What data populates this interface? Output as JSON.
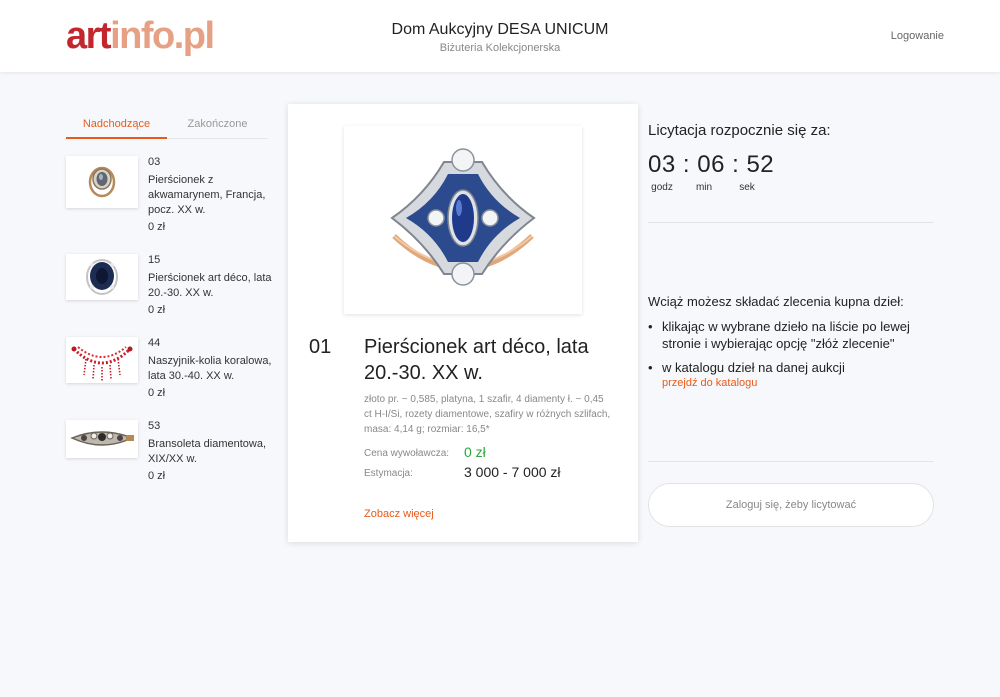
{
  "header": {
    "logo_part1": "art",
    "logo_part2": "info.pl",
    "title": "Dom Aukcyjny DESA UNICUM",
    "subtitle": "Biżuteria Kolekcjonerska",
    "login_label": "Logowanie"
  },
  "tabs": [
    {
      "label": "Nadchodzące",
      "active": true
    },
    {
      "label": "Zakończone",
      "active": false
    }
  ],
  "lots": [
    {
      "number": "03",
      "name": "Pierścionek z akwamarynem, Francja, pocz. XX w.",
      "price": "0 zł"
    },
    {
      "number": "15",
      "name": "Pierścionek art déco, lata 20.-30. XX w.",
      "price": "0 zł"
    },
    {
      "number": "44",
      "name": "Naszyjnik-kolia koralowa, lata 30.-40. XX w.",
      "price": "0 zł"
    },
    {
      "number": "53",
      "name": "Bransoleta diamentowa, XIX/XX w.",
      "price": "0 zł"
    }
  ],
  "selected_lot": {
    "number": "01",
    "title": "Pierścionek art déco, lata 20.-30. XX w.",
    "description": "złoto pr. ~ 0,585, platyna, 1 szafir, 4 diamenty ł. ~ 0,45 ct H-I/Si, rozety diamentowe, szafiry w różnych szlifach, masa: 4,14 g; rozmiar: 16,5*",
    "start_label": "Cena wywoławcza:",
    "start_value": "0 zł",
    "estimate_label": "Estymacja:",
    "estimate_value": "3 000 - 7 000 zł",
    "see_more": "Zobacz więcej"
  },
  "countdown": {
    "title": "Licytacja rozpocznie się za:",
    "hours": "03",
    "minutes": "06",
    "seconds": "52",
    "separator": ":",
    "hours_label": "godz",
    "minutes_label": "min",
    "seconds_label": "sek"
  },
  "orders": {
    "intro": "Wciąż możesz składać zlecenia kupna dzieł:",
    "bullet1": "klikając w wybrane dzieło na liście po lewej stronie i wybierając opcję \"złóż zlecenie\"",
    "bullet2": "w katalogu dzieł na danej aukcji",
    "catalog_link": "przejdź do katalogu",
    "bullet_char": "•"
  },
  "login_button": "Zaloguj się, żeby licytować",
  "colors": {
    "accent": "#e85a1a",
    "price_green": "#29a83a",
    "logo_red": "#c1272d",
    "logo_peach": "#e6a083"
  }
}
